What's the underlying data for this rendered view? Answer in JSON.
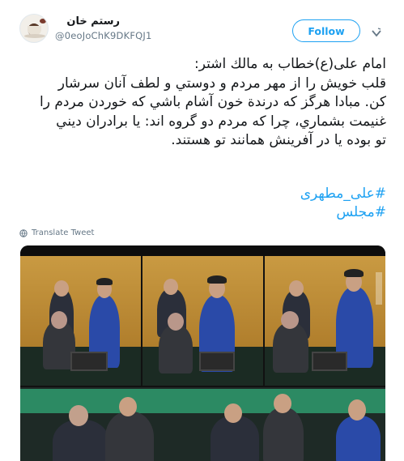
{
  "tweet": {
    "display_name": "رستم خان",
    "handle": "@0eoJoChK9DKFQJ1",
    "follow_label": "Follow",
    "text_lines": [
      "امام علی(ع)خطاب به مالك اشتر:",
      "قلب خويش را از مهر مردم و دوستي و لطف آنان سرشار",
      "كن. مبادا هرگز كه درندة خون آشام باشي كه خوردن مردم را",
      "غنيمت بشماري، چرا كه مردم دو گروه اند: يا برادران ديني",
      "تو بوده يا در آفرينش همانند تو هستند."
    ],
    "hashtags": [
      "#علی_مطهری",
      "#مجلس"
    ],
    "translate_label": "Translate Tweet"
  },
  "colors": {
    "accent": "#1da1f2",
    "text": "#14171a",
    "muted": "#657786"
  },
  "icons": {
    "avatar": "coffee-cup-avatar",
    "chevron": "chevron-down-icon",
    "globe": "globe-icon"
  }
}
